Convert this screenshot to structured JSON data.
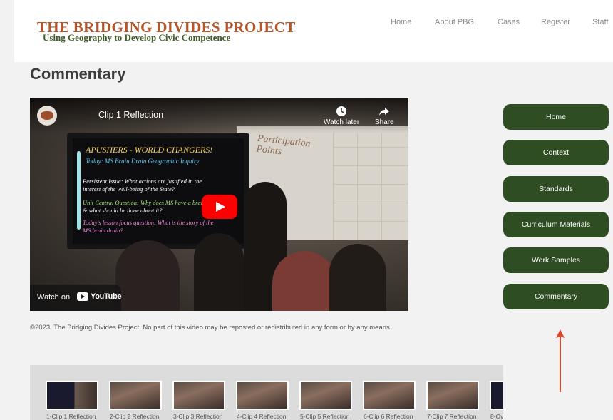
{
  "site": {
    "title": "THE BRIDGING DIVIDES PROJECT",
    "subtitle": "Using Geography to Develop Civic Competence"
  },
  "nav": [
    "Home",
    "About PBGI",
    "Cases",
    "Register",
    "Staff"
  ],
  "page_title": "Commentary",
  "video": {
    "title": "Clip 1 Reflection",
    "watch_later": "Watch later",
    "share": "Share",
    "watch_on": "Watch on",
    "youtube": "YouTube",
    "screen_title": "APUSHERS - WORLD CHANGERS!",
    "screen_subtitle": "Today: MS Brain Drain Geographic Inquiry",
    "screen_lines": [
      "Persistent Issue: What actions are justified in the",
      "interest of the well-being of the State?",
      "Unit Central Question: Why does MS have a brain drain",
      "& what should be done about it?",
      "Today's lesson focus question: What is the story of the",
      "MS brain drain?"
    ],
    "whiteboard_text": "Participation Points"
  },
  "copyright": "©2023, The Bridging Divides Project. No part of this video may be reposted or redistributed in any form or by any means.",
  "sidebar": [
    "Home",
    "Context",
    "Standards",
    "Curriculum Materials",
    "Work Samples",
    "Commentary"
  ],
  "colors": {
    "brand_title": "#b5562a",
    "brand_subtitle": "#3f5e27",
    "sidebar_button": "#2f4d22",
    "arrow": "#e0442a",
    "youtube_red": "#ff0000"
  },
  "thumbnails": [
    "1-Clip 1 Reflection",
    "2-Clip 2 Reflection",
    "3-Clip 3 Reflection",
    "4-Clip 4 Reflection",
    "5-Clip 5 Reflection",
    "6-Clip 6 Reflection",
    "7-Clip 7 Reflection",
    "8-Ov"
  ]
}
